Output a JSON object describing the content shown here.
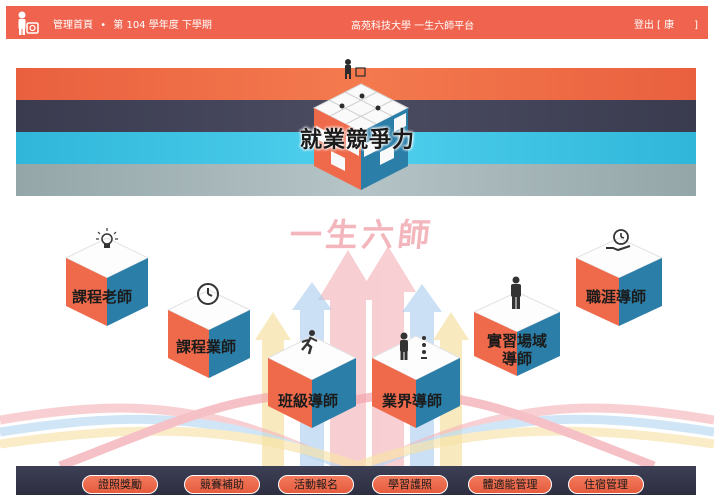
{
  "header": {
    "breadcrumb_home": "管理首頁",
    "separator": "•",
    "term": "第 104 學年度 下學期",
    "site_title": "高苑科技大學 一生六師平台",
    "logout": "登出 [ 康　　]"
  },
  "banner": {
    "label": "就業競爭力"
  },
  "main": {
    "motto": "一生六師",
    "mentors": [
      {
        "id": "course-teacher",
        "label": "課程老師",
        "icon": "lightbulb-icon"
      },
      {
        "id": "course-industry",
        "label": "課程業師",
        "icon": "clock-icon"
      },
      {
        "id": "class-mentor",
        "label": "班級導師",
        "icon": "runner-icon"
      },
      {
        "id": "industry-mentor",
        "label": "業界導師",
        "icon": "businessman-icon"
      },
      {
        "id": "internship-mentor",
        "label_line1": "實習場域",
        "label_line2": "導師",
        "icon": "standing-person-icon"
      },
      {
        "id": "career-mentor",
        "label": "職涯導師",
        "icon": "hand-clock-icon"
      }
    ]
  },
  "bottom_nav": {
    "items": [
      "證照獎勵",
      "競賽補助",
      "活動報名",
      "學習護照",
      "體適能管理",
      "住宿管理"
    ]
  },
  "colors": {
    "accent": "#f0644f",
    "cube_orange": "#ef6a4b",
    "cube_blue": "#2a7ea8",
    "nav_dark": "#33354a"
  }
}
